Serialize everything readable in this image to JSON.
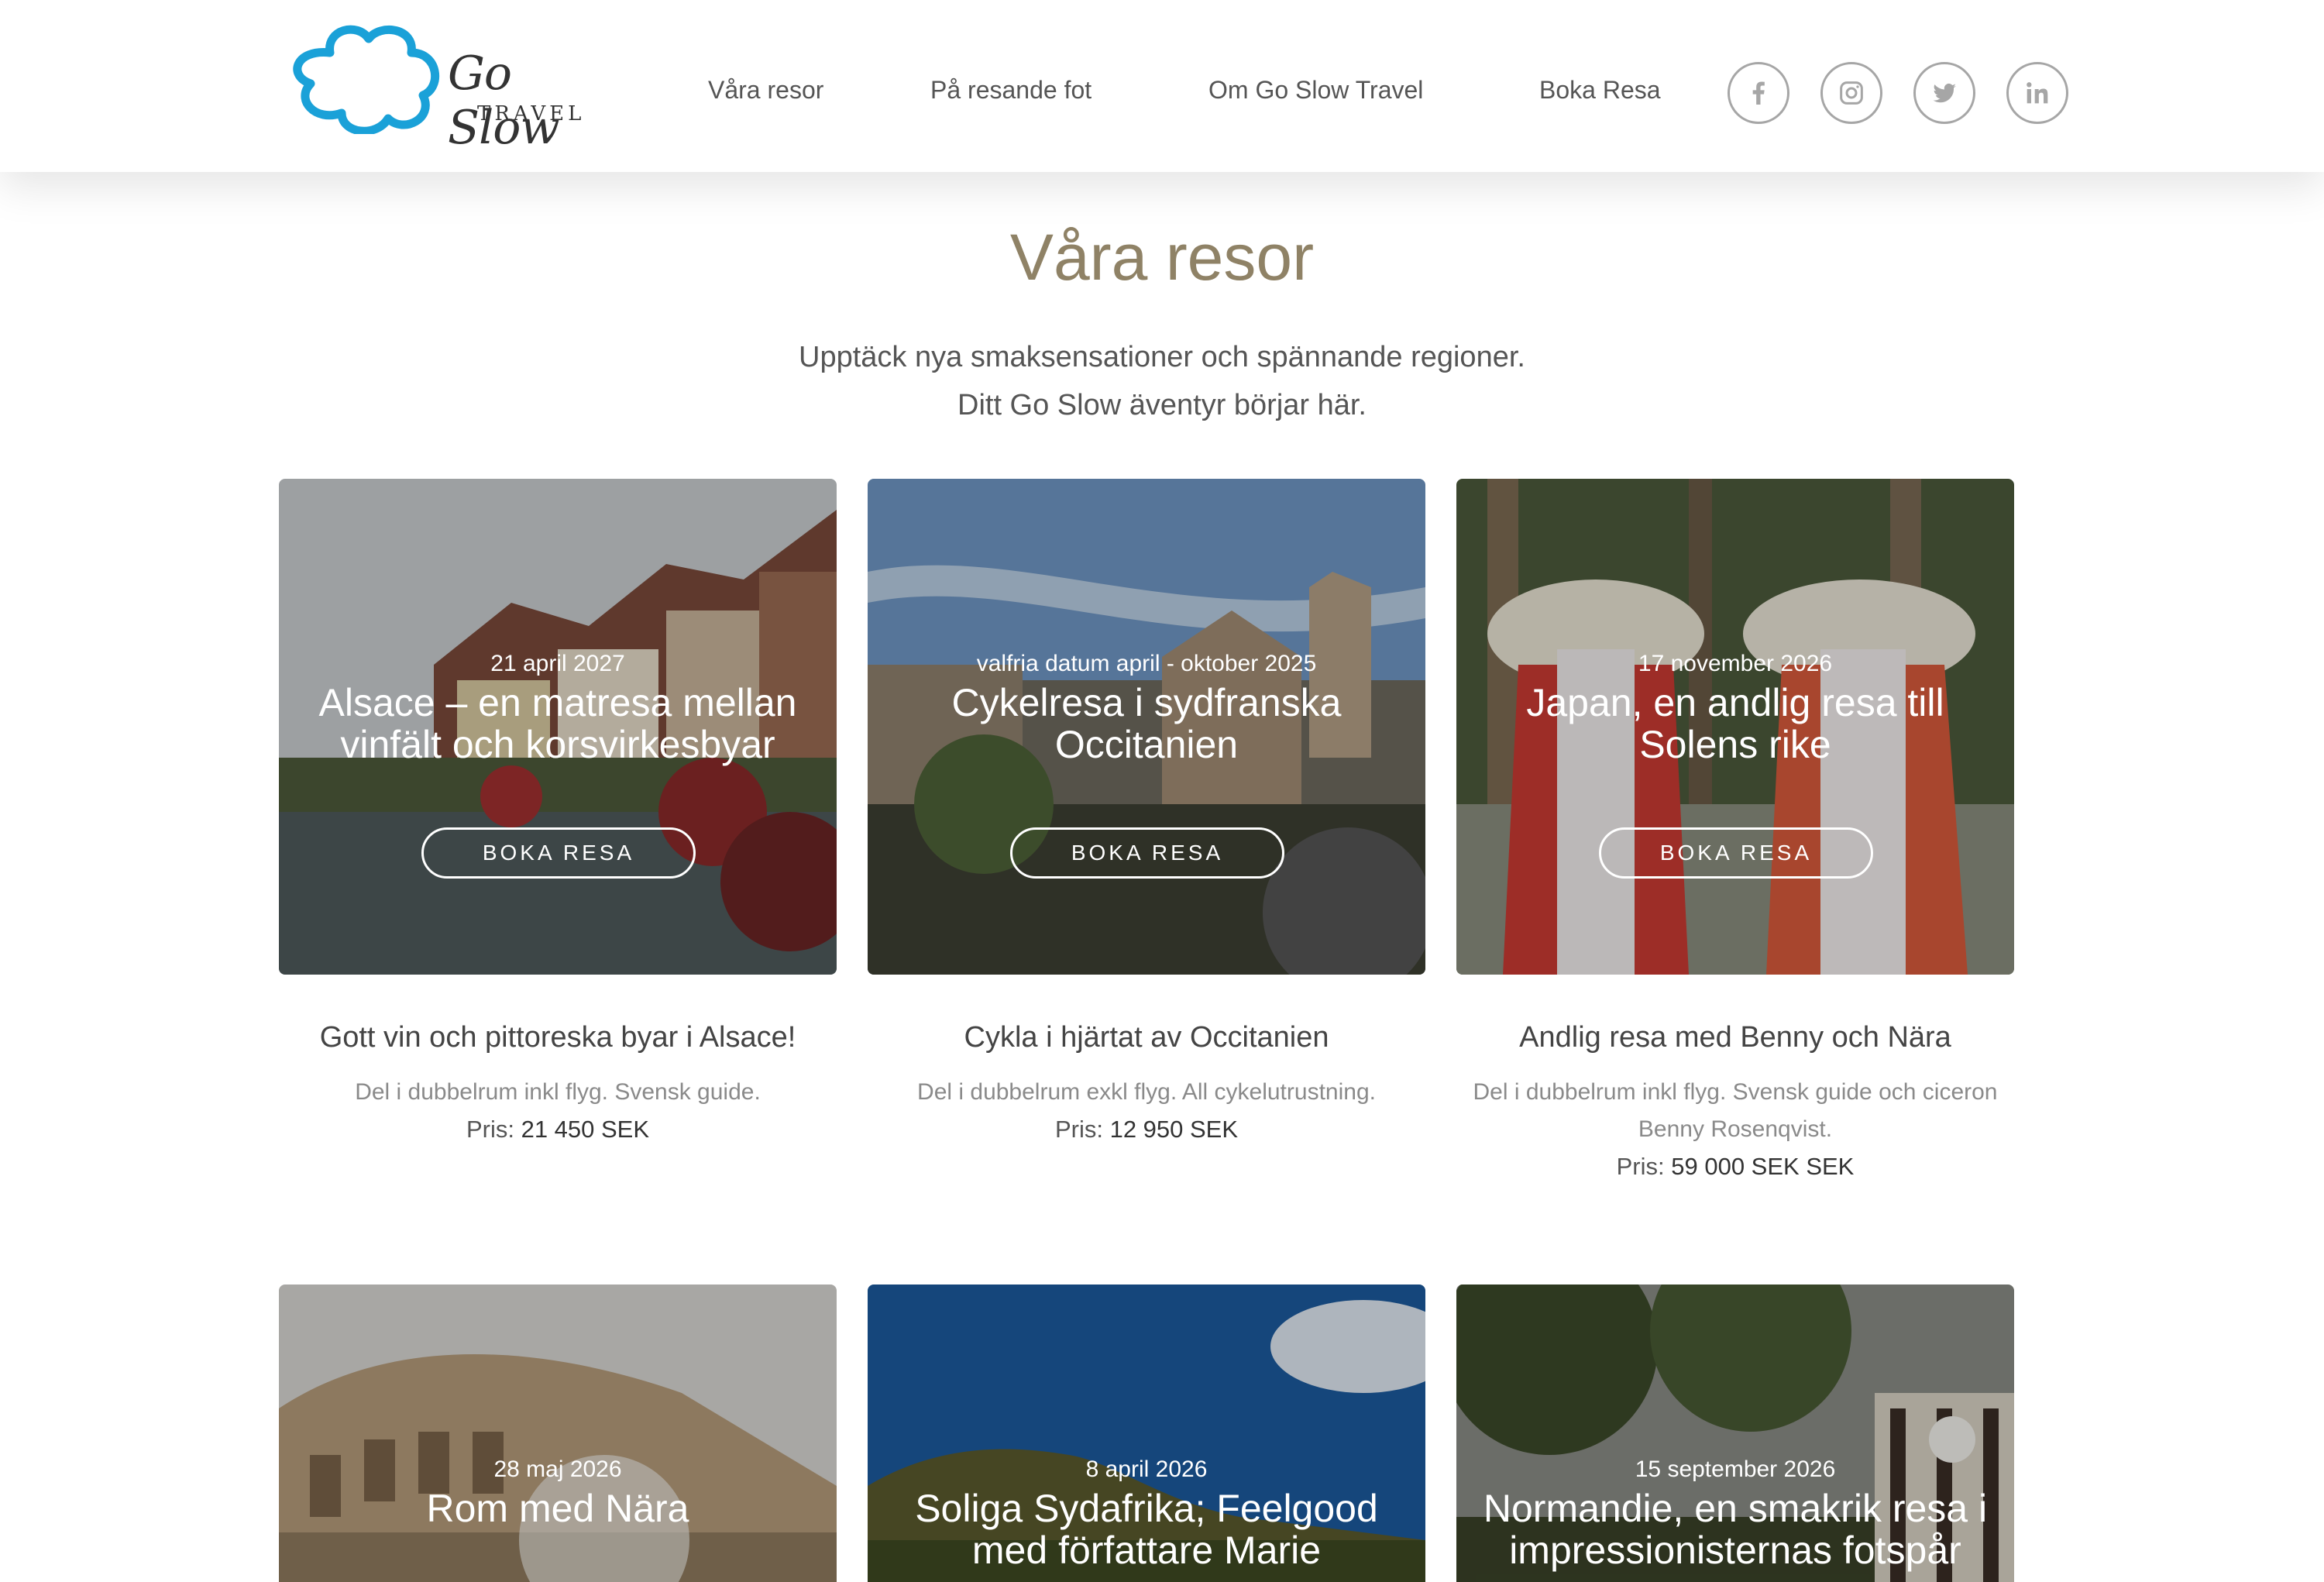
{
  "brand": {
    "name": "Go Slow",
    "sub": "TRAVEL",
    "logo_icon": "cloud-logo-icon"
  },
  "nav": [
    {
      "label": "Våra resor"
    },
    {
      "label": "På resande fot"
    },
    {
      "label": "Om Go Slow Travel"
    },
    {
      "label": "Boka Resa"
    }
  ],
  "social": [
    "facebook-icon",
    "instagram-icon",
    "twitter-icon",
    "linkedin-icon"
  ],
  "colors": {
    "title": "#8f8266",
    "logo_blue": "#1aa1d8"
  },
  "page_title": "Våra resor",
  "intro": {
    "line1": "Upptäck nya smaksensationer och spännande regioner.",
    "line2": "Ditt Go Slow äventyr börjar här."
  },
  "button_label": "BOKA RESA",
  "price_label": "Pris:",
  "trips": [
    {
      "date": "21 april 2027",
      "title": "Alsace – en matresa mellan vinfält och korsvirkesbyar",
      "subtitle": "Gott vin och pittoreska byar i Alsace!",
      "description": "Del i dubbelrum inkl flyg. Svensk guide.",
      "price": "21 450 SEK"
    },
    {
      "date": "valfria datum april - oktober 2025",
      "title": "Cykelresa i sydfranska Occitanien",
      "subtitle": "Cykla i hjärtat av Occitanien",
      "description": "Del i dubbelrum exkl flyg. All cykelutrustning.",
      "price": "12 950 SEK"
    },
    {
      "date": "17 november 2026",
      "title": "Japan, en andlig resa till Solens rike",
      "subtitle": "Andlig resa med Benny och Nära",
      "description": "Del i dubbelrum inkl flyg. Svensk guide och ciceron Benny Rosenqvist.",
      "price": "59 000 SEK SEK"
    },
    {
      "date": "28 maj 2026",
      "title": "Rom med Nära"
    },
    {
      "date": "8 april 2026",
      "title": "Soliga Sydafrika; Feelgood med författare Marie"
    },
    {
      "date": "15 september 2026",
      "title": "Normandie, en smakrik resa i impressionisternas fotspår"
    }
  ]
}
